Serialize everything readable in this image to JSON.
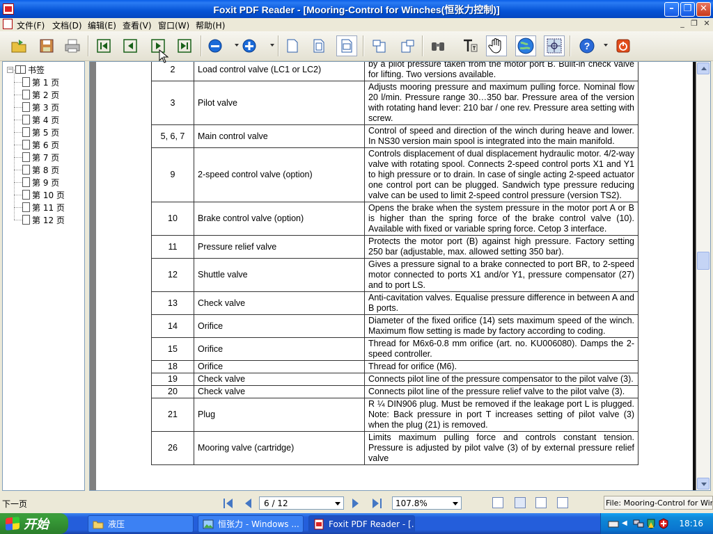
{
  "window": {
    "title": "Foxit PDF Reader - [Mooring-Control for Winches(恒张力控制)]"
  },
  "menu": {
    "items": [
      "文件(F)",
      "文档(D)",
      "编辑(E)",
      "查看(V)",
      "窗口(W)",
      "帮助(H)"
    ]
  },
  "toolbar": {
    "icons": [
      "open-icon",
      "save-icon",
      "print-icon",
      "first-page-icon",
      "previous-page-icon",
      "next-page-icon",
      "last-page-icon",
      "zoom-out-icon",
      "zoom-in-icon",
      "actual-size-icon",
      "fit-page-icon",
      "fit-width-icon",
      "rotate-left-icon",
      "rotate-right-icon",
      "find-icon",
      "text-select-icon",
      "hand-tool-icon",
      "web-icon",
      "snapshot-icon",
      "help-icon",
      "exit-icon"
    ]
  },
  "bookmarks": {
    "root_label": "书签",
    "items": [
      "第 1 页",
      "第 2 页",
      "第 3 页",
      "第 4 页",
      "第 5 页",
      "第 6 页",
      "第 7 页",
      "第 8 页",
      "第 9 页",
      "第 10 页",
      "第 11 页",
      "第 12 页"
    ]
  },
  "table": {
    "rows": [
      {
        "num": "2",
        "name": "Load control valve (LC1 or LC2)",
        "desc": "by a pilot pressure taken from the motor port B. Built-in check valve for lifting. Two versions available."
      },
      {
        "num": "3",
        "name": "Pilot valve",
        "desc": "Adjusts mooring pressure and maximum pulling force. Nominal flow 20 l/min. Pressure range 30…350 bar. Pressure area of the version with rotating hand lever: 210 bar / one rev. Pressure area setting with screw."
      },
      {
        "num": "5, 6, 7",
        "name": "Main control valve",
        "desc": "Control of speed and direction of the winch during heave and lower. In NS30 version main spool is integrated into the main manifold."
      },
      {
        "num": "9",
        "name": "2-speed control valve (option)",
        "desc": "Controls displacement of dual displacement hydraulic motor. 4/2-way valve with rotating spool. Connects 2-speed control ports X1 and Y1 to high pressure or to drain. In case of single acting 2-speed actuator one control port can be plugged. Sandwich type pressure reducing valve can be used to limit 2-speed control pressure (version TS2)."
      },
      {
        "num": "10",
        "name": "Brake control valve (option)",
        "desc": "Opens the brake when the system pressure in the motor port A or B is higher than the spring force of the brake control valve (10). Available with fixed or variable spring force. Cetop 3 interface."
      },
      {
        "num": "11",
        "name": "Pressure relief valve",
        "desc": "Protects the motor port (B) against high pressure. Factory setting 250 bar (adjustable, max. allowed setting 350 bar)."
      },
      {
        "num": "12",
        "name": "Shuttle valve",
        "desc": "Gives a pressure signal to a brake connected to port BR, to 2-speed motor connected to ports X1 and/or Y1, pressure compensator (27) and to port LS."
      },
      {
        "num": "13",
        "name": "Check valve",
        "desc": "Anti-cavitation valves. Equalise pressure difference in between A and B ports."
      },
      {
        "num": "14",
        "name": "Orifice",
        "desc": "Diameter of the fixed orifice (14) sets maximum speed of the winch. Maximum flow setting is made by factory according to coding."
      },
      {
        "num": "15",
        "name": "Orifice",
        "desc": "Thread for M6x6-0.8 mm orifice (art. no. KU006080). Damps the 2-speed controller."
      },
      {
        "num": "18",
        "name": "Orifice",
        "desc": "Thread for orifice (M6)."
      },
      {
        "num": "19",
        "name": "Check valve",
        "desc": "Connects pilot line of the pressure compensator to the pilot valve (3)."
      },
      {
        "num": "20",
        "name": "Check valve",
        "desc": "Connects pilot line of the pressure relief valve to the pilot valve (3)."
      },
      {
        "num": "21",
        "name": "Plug",
        "desc": "R ¼ DIN906 plug.  Must be removed if the leakage port L is plugged.  Note: Back pressure in port T increases setting of pilot valve (3) when the plug (21) is removed."
      },
      {
        "num": "26",
        "name": "Mooring valve (cartridge)",
        "desc": "Limits maximum pulling force and controls constant tension.  Pressure is adjusted by pilot valve (3) of by external pressure relief valve"
      }
    ]
  },
  "statusbar": {
    "hint": "下一页",
    "page_indicator": "6 / 12",
    "zoom": "107.8%",
    "file_label": "File: Mooring-Control for Winches"
  },
  "taskbar": {
    "start_label": "开始",
    "tasks": [
      "液压",
      "恒张力 - Windows ...",
      "Foxit PDF Reader - [..."
    ],
    "clock": "18:16"
  },
  "scroll": {
    "position_fraction": 0.46
  }
}
